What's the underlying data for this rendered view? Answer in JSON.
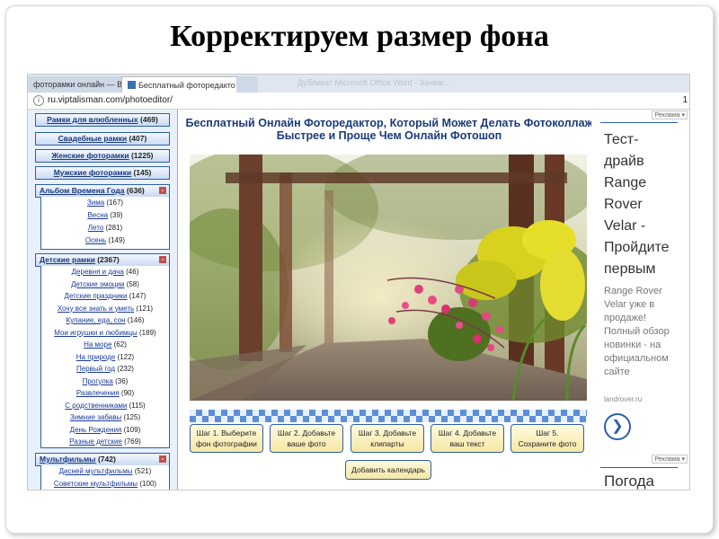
{
  "slide": {
    "title": "Корректируем размер фона"
  },
  "browser": {
    "tabs": [
      "фоторамки онлайн — В",
      "Бесплатный фоторедакто",
      ""
    ],
    "tab_close": "×",
    "tab_faded": "Дубликат Microsoft Office Word - Зачем...",
    "address_info": "i",
    "address": "ru.viptalisman.com/photoeditor/",
    "address_right": "1"
  },
  "sidebar": {
    "categories_top": [
      {
        "name": "Рамки для влюбленных",
        "count": "(469)"
      },
      {
        "name": "Свадебные рамки",
        "count": "(407)"
      },
      {
        "name": "Женские фоторамки",
        "count": "(1225)"
      },
      {
        "name": "Мужские фоторамки",
        "count": "(145)"
      }
    ],
    "album": {
      "name": "Альбом Времена Года",
      "count": "(636)",
      "toggle": "-",
      "items": [
        {
          "name": "Зима",
          "count": "(167)"
        },
        {
          "name": "Весна",
          "count": "(39)"
        },
        {
          "name": "Лето",
          "count": "(281)"
        },
        {
          "name": "Осень",
          "count": "(149)"
        }
      ]
    },
    "kids": {
      "name": "Детские рамки",
      "count": "(2367)",
      "toggle": "-",
      "items": [
        {
          "name": "Деревня и дача",
          "count": "(46)"
        },
        {
          "name": "Детские эмоции",
          "count": "(58)"
        },
        {
          "name": "Детские праздники",
          "count": "(147)"
        },
        {
          "name": "Хочу все знать и уметь",
          "count": "(121)"
        },
        {
          "name": "Купание, еда, сон",
          "count": "(146)"
        },
        {
          "name": "Мои игрушки и любимцы",
          "count": "(189)"
        },
        {
          "name": "На море",
          "count": "(62)"
        },
        {
          "name": "На природе",
          "count": "(122)"
        },
        {
          "name": "Первый год",
          "count": "(232)"
        },
        {
          "name": "Прогулка",
          "count": "(36)"
        },
        {
          "name": "Развлечения",
          "count": "(90)"
        },
        {
          "name": "С родственниками",
          "count": "(115)"
        },
        {
          "name": "Зимние забавы",
          "count": "(125)"
        },
        {
          "name": "День Рождения",
          "count": "(109)"
        },
        {
          "name": "Разные детские",
          "count": "(769)"
        }
      ]
    },
    "cartoons": {
      "name": "Мультфильмы",
      "count": "(742)",
      "toggle": "-",
      "items": [
        {
          "name": "Дисней мультфильмы",
          "count": "(521)"
        },
        {
          "name": "Советские мультфильмы",
          "count": "(100)"
        }
      ]
    }
  },
  "main": {
    "title_line1": "Бесплатный Онлайн Фоторедактор, Который Может Делать Фотоколлаж",
    "title_line2": "Быстрее и Проще Чем Онлайн Фотошоп",
    "steps": [
      {
        "line1": "Шаг 1. Выберите",
        "line2": "фон фотографии"
      },
      {
        "line1": "Шаг 2. Добавьте",
        "line2": "ваше фото"
      },
      {
        "line1": "Шаг 3. Добавьте",
        "line2": "клипарты"
      },
      {
        "line1": "Шаг 4. Добавьте",
        "line2": "ваш текст"
      },
      {
        "line1": "Шаг 5.",
        "line2": "Сохраните фото"
      }
    ],
    "calendar_button": "Добавить календарь"
  },
  "ad": {
    "label": "Реклама ▾",
    "big": [
      "Тест-",
      "драйв",
      "Range",
      "Rover",
      "Velar -",
      "Пройдите",
      "первым"
    ],
    "small": [
      "Range Rover",
      "Velar уже в",
      "продаже!",
      "Полный обзор",
      "новинки - на",
      "официальном",
      "сайте"
    ],
    "domain": "landrover.ru",
    "arrow": "❯",
    "label2": "Реклама ▾",
    "pogoda": "Погода"
  },
  "colors": {
    "accent": "#2d5fa8",
    "sidebar_bg": "#e8f0fb",
    "button_bg": "#f6e7a3"
  }
}
